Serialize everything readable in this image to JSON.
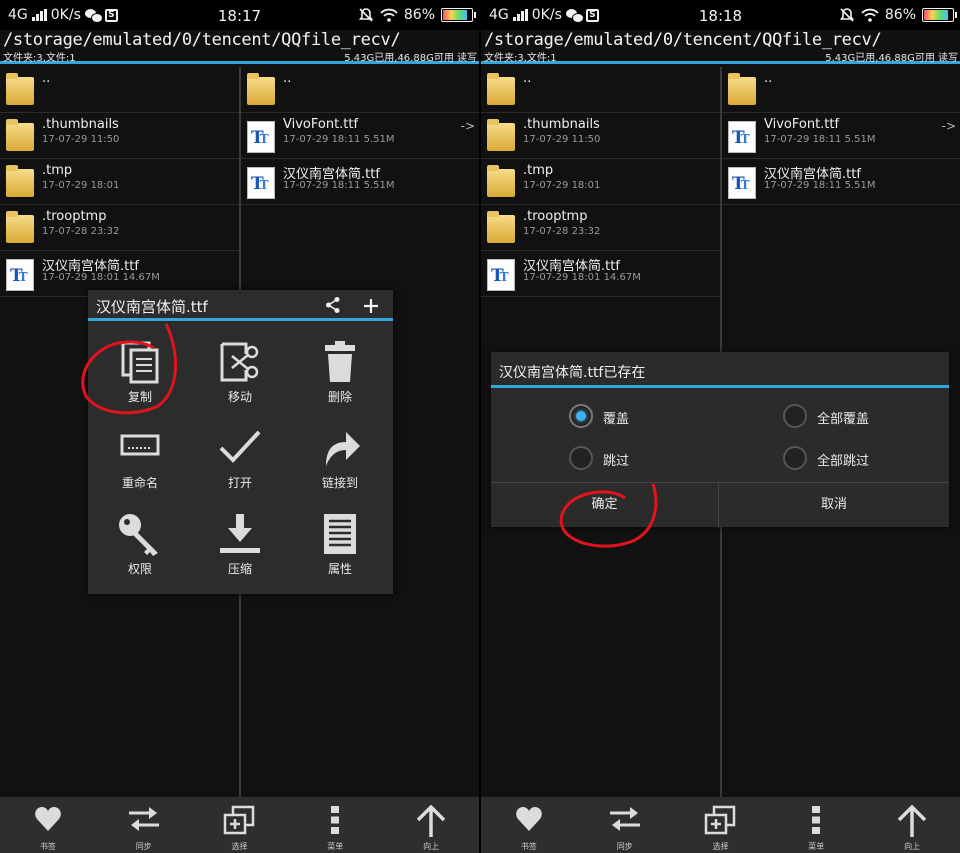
{
  "common": {
    "network": "4G",
    "speed": "0K/s",
    "s_badge": "S",
    "battery": "86%",
    "path": "/storage/emulated/0/tencent/QQfile_recv/",
    "counts": "文件夹:3,文件:1",
    "storage": "5.43G已用,46.88G可用 读写",
    "left_files": [
      {
        "name": "..",
        "meta": "",
        "type": "folder"
      },
      {
        "name": ".thumbnails",
        "meta": "17-07-29 11:50",
        "type": "folder"
      },
      {
        "name": ".tmp",
        "meta": "17-07-29 18:01",
        "type": "folder"
      },
      {
        "name": ".trooptmp",
        "meta": "17-07-28 23:32",
        "type": "folder"
      },
      {
        "name": "汉仪南宫体简.ttf",
        "meta": "17-07-29 18:01  14.67M",
        "type": "ttf"
      }
    ],
    "right_files": [
      {
        "name": "..",
        "meta": "",
        "type": "folder"
      },
      {
        "name": "VivoFont.ttf",
        "meta": "17-07-29 18:11  5.51M",
        "type": "ttf",
        "arrow": "->"
      },
      {
        "name": "汉仪南宫体简.ttf",
        "meta": "17-07-29 18:11  5.51M",
        "type": "ttf"
      }
    ],
    "bottom": [
      {
        "label": "书签",
        "icon": "heart-icon"
      },
      {
        "label": "同步",
        "icon": "sync-arrows-icon"
      },
      {
        "label": "选择",
        "icon": "select-stack-icon"
      },
      {
        "label": "菜单",
        "icon": "menu-dots-icon"
      },
      {
        "label": "向上",
        "icon": "up-arrow-icon"
      }
    ]
  },
  "left": {
    "time": "18:17",
    "context_menu": {
      "title": "汉仪南宫体简.ttf",
      "items": [
        {
          "label": "复制",
          "icon": "copy-icon"
        },
        {
          "label": "移动",
          "icon": "cut-move-icon"
        },
        {
          "label": "删除",
          "icon": "trash-icon"
        },
        {
          "label": "重命名",
          "icon": "rename-icon"
        },
        {
          "label": "打开",
          "icon": "checkmark-icon"
        },
        {
          "label": "链接到",
          "icon": "link-arrow-icon"
        },
        {
          "label": "权限",
          "icon": "key-icon"
        },
        {
          "label": "压缩",
          "icon": "compress-icon"
        },
        {
          "label": "属性",
          "icon": "properties-icon"
        }
      ]
    }
  },
  "right": {
    "time": "18:18",
    "dialog": {
      "title": "汉仪南宫体简.ttf已存在",
      "options": [
        {
          "label": "覆盖",
          "selected": true
        },
        {
          "label": "全部覆盖",
          "selected": false
        },
        {
          "label": "跳过",
          "selected": false
        },
        {
          "label": "全部跳过",
          "selected": false
        }
      ],
      "ok": "确定",
      "cancel": "取消"
    }
  },
  "colors": {
    "accent": "#35a6dc",
    "annotation": "#e0141e"
  }
}
